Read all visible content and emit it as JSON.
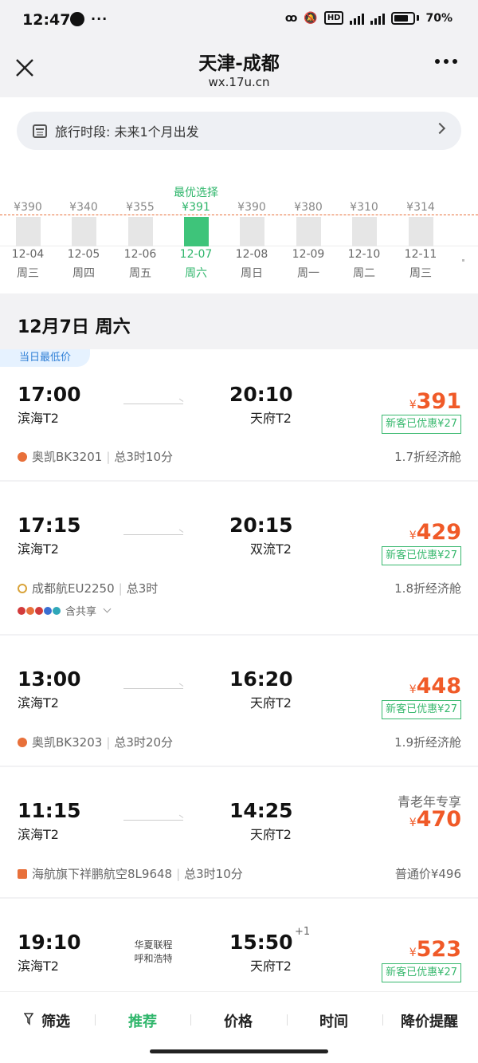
{
  "status_bar": {
    "time": "12:47",
    "battery": "70%",
    "network": [
      "HD",
      "5G",
      "5G"
    ]
  },
  "header": {
    "title": "天津-成都",
    "subtitle": "wx.17u.cn"
  },
  "travel_period": {
    "label": "旅行时段: 未来1个月出发"
  },
  "date_strip": {
    "best_label": "最优选择",
    "days": [
      {
        "price": "¥390",
        "date": "12-04",
        "weekday": "周三"
      },
      {
        "price": "¥340",
        "date": "12-05",
        "weekday": "周四"
      },
      {
        "price": "¥355",
        "date": "12-06",
        "weekday": "周五"
      },
      {
        "price": "¥391",
        "date": "12-07",
        "weekday": "周六",
        "selected": true
      },
      {
        "price": "¥390",
        "date": "12-08",
        "weekday": "周日"
      },
      {
        "price": "¥380",
        "date": "12-09",
        "weekday": "周一"
      },
      {
        "price": "¥310",
        "date": "12-10",
        "weekday": "周二"
      },
      {
        "price": "¥314",
        "date": "12-11",
        "weekday": "周三"
      }
    ]
  },
  "selected_date": "12月7日 周六",
  "flights": [
    {
      "badge": "当日最低价",
      "dep_time": "17:00",
      "dep_airport": "滨海T2",
      "arr_time": "20:10",
      "arr_airport": "天府T2",
      "yen": "¥",
      "price": "391",
      "promo": "新客已优惠¥27",
      "airline": "奥凯BK3201",
      "duration": "总3时10分",
      "cabin": "1.7折经济舱"
    },
    {
      "dep_time": "17:15",
      "dep_airport": "滨海T2",
      "arr_time": "20:15",
      "arr_airport": "双流T2",
      "yen": "¥",
      "price": "429",
      "promo": "新客已优惠¥27",
      "airline": "成都航EU2250",
      "duration": "总3时",
      "cabin": "1.8折经济舱",
      "share": "含共享"
    },
    {
      "dep_time": "13:00",
      "dep_airport": "滨海T2",
      "arr_time": "16:20",
      "arr_airport": "天府T2",
      "yen": "¥",
      "price": "448",
      "promo": "新客已优惠¥27",
      "airline": "奥凯BK3203",
      "duration": "总3时20分",
      "cabin": "1.9折经济舱"
    },
    {
      "tag": "青老年专享",
      "dep_time": "11:15",
      "dep_airport": "滨海T2",
      "arr_time": "14:25",
      "arr_airport": "天府T2",
      "yen": "¥",
      "price": "470",
      "airline": "海航旗下祥鹏航空8L9648",
      "duration": "总3时10分",
      "cabin": "普通价¥496"
    },
    {
      "dep_time": "19:10",
      "dep_airport": "滨海T2",
      "arr_time": "15:50",
      "arr_airport": "天府T2",
      "plus_day": "+1",
      "via_line1": "华夏联程",
      "via_line2": "呼和浩特",
      "yen": "¥",
      "price": "523",
      "promo": "新客已优惠¥27"
    }
  ],
  "bottom_tabs": {
    "filter": "筛选",
    "recommend": "推荐",
    "price": "价格",
    "time": "时间",
    "alert": "降价提醒"
  },
  "colors": {
    "accent_green": "#2fb66b",
    "price_orange": "#f05a28",
    "badge_blue": "#2f7fd6"
  }
}
